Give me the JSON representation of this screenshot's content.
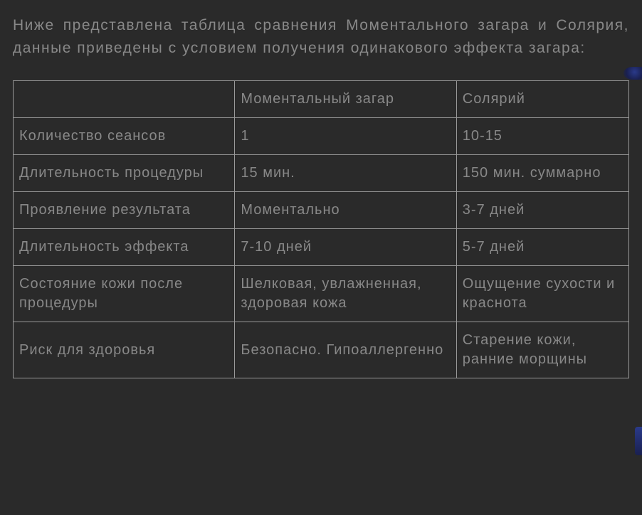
{
  "intro": "Ниже представлена таблица сравнения Моментального загара и Солярия, данные приведены с условием получения одинакового эффекта загара:",
  "table": {
    "headers": {
      "blank": "",
      "col1": "Моментальный загар",
      "col2": "Солярий"
    },
    "rows": [
      {
        "label": "Количество сеансов",
        "col1": "1",
        "col2": "10-15"
      },
      {
        "label": "Длительность процедуры",
        "col1": "15 мин.",
        "col2": "150 мин. суммарно"
      },
      {
        "label": "Проявление результата",
        "col1": "Моментально",
        "col2": "3-7 дней"
      },
      {
        "label": "Длительность эффекта",
        "col1": "7-10 дней",
        "col2": "5-7 дней"
      },
      {
        "label": "Состояние кожи после процедуры",
        "col1": "Шелковая, увлажненная, здоровая кожа",
        "col2": "Ощущение сухости и краснота"
      },
      {
        "label": "Риск для здоровья",
        "col1": "Безопасно. Гипоаллергенно",
        "col2": "Старение кожи, ранние морщины"
      }
    ]
  }
}
